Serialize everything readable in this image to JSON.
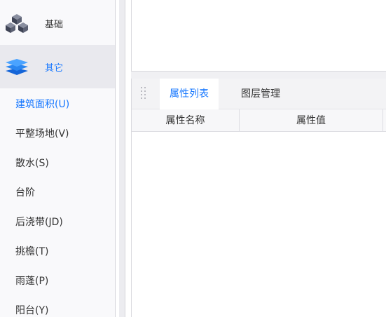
{
  "sidebar": {
    "categories": [
      {
        "label": "基础",
        "icon": "cubes-icon"
      },
      {
        "label": "其它",
        "icon": "layers-icon",
        "selected": true
      }
    ],
    "items": [
      {
        "label": "建筑面积(U)",
        "active": true
      },
      {
        "label": "平整场地(V)"
      },
      {
        "label": "散水(S)"
      },
      {
        "label": "台阶"
      },
      {
        "label": "后浇带(JD)"
      },
      {
        "label": "挑檐(T)"
      },
      {
        "label": "雨蓬(P)"
      },
      {
        "label": "阳台(Y)"
      }
    ]
  },
  "panel": {
    "tabs": [
      {
        "label": "属性列表",
        "active": true
      },
      {
        "label": "图层管理"
      }
    ],
    "table": {
      "columns": [
        "属性名称",
        "属性值"
      ],
      "rows": []
    }
  },
  "colors": {
    "accent": "#1677ff",
    "sidebar_bg": "#f9f9fb",
    "selected_bg": "#e9e9ee",
    "text": "#333333"
  }
}
